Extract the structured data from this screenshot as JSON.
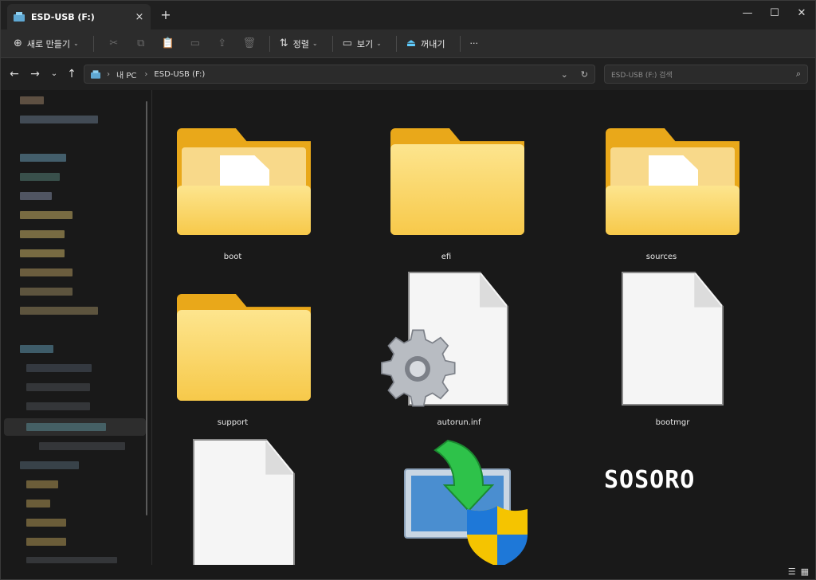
{
  "tab": {
    "title": "ESD-USB (F:)",
    "close": "×",
    "new": "+"
  },
  "window_controls": {
    "minimize": "—",
    "maximize": "☐",
    "close": "✕"
  },
  "commands": {
    "new": "새로 만들기",
    "sort": "정렬",
    "view": "보기",
    "eject": "꺼내기",
    "more": "···"
  },
  "address": {
    "crumbs": [
      "내 PC",
      "ESD-USB (F:)"
    ],
    "search_placeholder": "ESD-USB (F:) 검색"
  },
  "items": [
    {
      "name": "boot",
      "kind": "folder-doc"
    },
    {
      "name": "efi",
      "kind": "folder"
    },
    {
      "name": "sources",
      "kind": "folder-doc"
    },
    {
      "name": "support",
      "kind": "folder"
    },
    {
      "name": "autorun.inf",
      "kind": "settings-file"
    },
    {
      "name": "bootmgr",
      "kind": "file"
    },
    {
      "name": "",
      "kind": "file"
    },
    {
      "name": "",
      "kind": "setup-exe"
    }
  ],
  "watermark": "SOSORO",
  "colors": {
    "accent": "#60cdff",
    "folder": "#f7c94a",
    "background": "#191919"
  }
}
